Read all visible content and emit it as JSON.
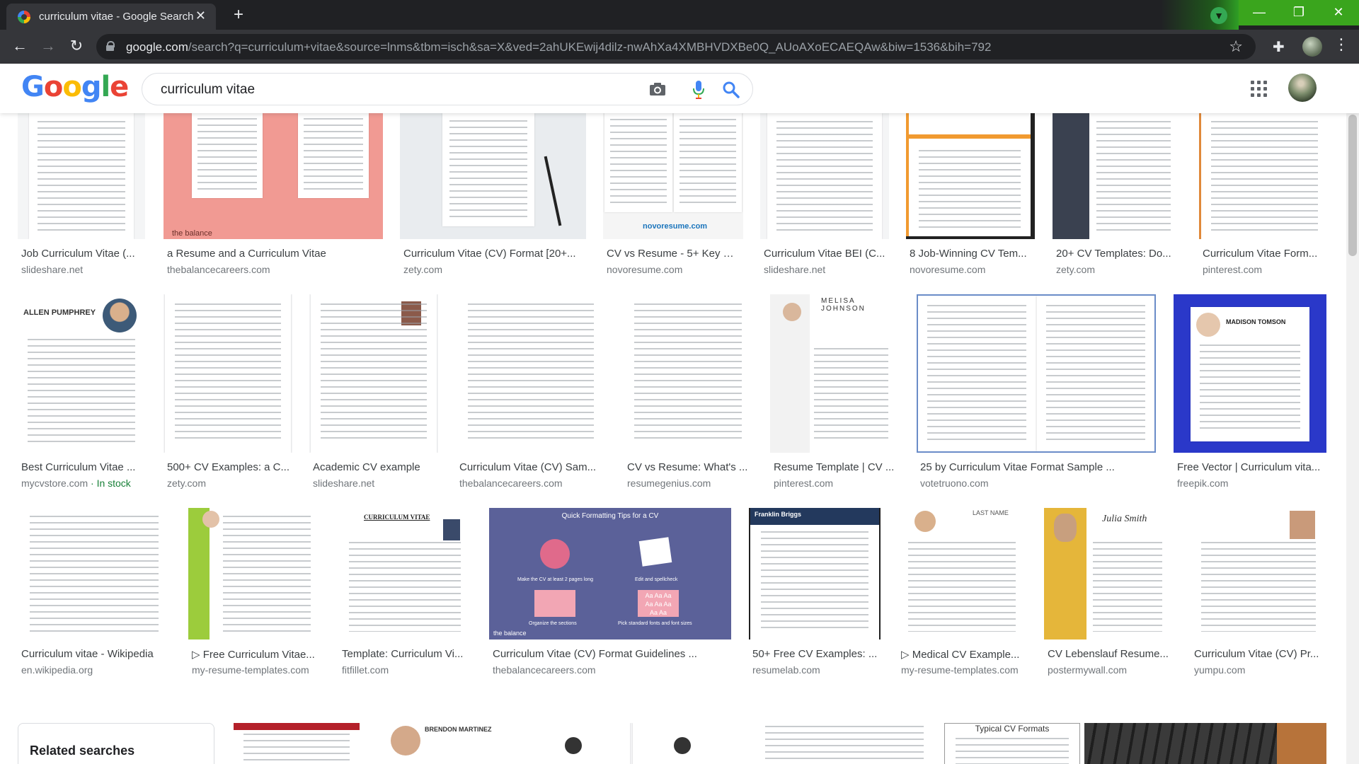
{
  "browser": {
    "tab_title": "curriculum vitae - Google Search",
    "tab_close": "✕",
    "new_tab": "+",
    "window_controls": [
      "—",
      "❐",
      "✕"
    ],
    "url_host": "google.com",
    "url_rest": "/search?q=curriculum+vitae&source=lnms&tbm=isch&sa=X&ved=2ahUKEwij4dilz-nwAhXa4XMBHVDXBe0Q_AUoAXoECAEQAw&biw=1536&bih=792",
    "nav": {
      "back": "←",
      "forward": "→",
      "reload": "↻"
    },
    "bookmark_icon": "☆",
    "extensions_icon": "puzzle-icon",
    "menu_icon": "⋮",
    "accent": "#3aa51d"
  },
  "google": {
    "logo_letters": [
      {
        "ch": "G",
        "color": "#4285f4"
      },
      {
        "ch": "o",
        "color": "#ea4335"
      },
      {
        "ch": "o",
        "color": "#fbbc05"
      },
      {
        "ch": "g",
        "color": "#4285f4"
      },
      {
        "ch": "l",
        "color": "#34a853"
      },
      {
        "ch": "e",
        "color": "#ea4335"
      }
    ],
    "query": "curriculum vitae"
  },
  "results": {
    "row1": [
      {
        "caption": "Job Curriculum Vitae (...",
        "source": "slideshare.net"
      },
      {
        "caption": "a Resume and a Curriculum Vitae",
        "source": "thebalancecareers.com"
      },
      {
        "caption": "Curriculum Vitae (CV) Format [20+...",
        "source": "zety.com"
      },
      {
        "caption": "CV vs Resume - 5+ Key Di...",
        "source": "novoresume.com"
      },
      {
        "caption": "Curriculum Vitae BEI (C...",
        "source": "slideshare.net"
      },
      {
        "caption": "8 Job-Winning CV Tem...",
        "source": "novoresume.com"
      },
      {
        "caption": "20+ CV Templates: Do...",
        "source": "zety.com"
      },
      {
        "caption": "Curriculum Vitae Form...",
        "source": "pinterest.com"
      }
    ],
    "row2": [
      {
        "caption": "Best Curriculum Vitae ...",
        "source": "mycvstore.com",
        "stock": " · In stock"
      },
      {
        "caption": "500+ CV Examples: a C...",
        "source": "zety.com"
      },
      {
        "caption": "Academic CV example",
        "source": "slideshare.net"
      },
      {
        "caption": "Curriculum Vitae (CV) Sam...",
        "source": "thebalancecareers.com"
      },
      {
        "caption": "CV vs Resume: What's ...",
        "source": "resumegenius.com"
      },
      {
        "caption": "Resume Template | CV ...",
        "source": "pinterest.com"
      },
      {
        "caption": "25 by Curriculum Vitae Format Sample ...",
        "source": "votetruono.com"
      },
      {
        "caption": "Free Vector | Curriculum vita...",
        "source": "freepik.com"
      }
    ],
    "row3": [
      {
        "caption": "Curriculum vitae - Wikipedia",
        "source": "en.wikipedia.org"
      },
      {
        "caption": "▷ Free Curriculum Vitae...",
        "source": "my-resume-templates.com"
      },
      {
        "caption": "Template: Curriculum Vi...",
        "source": "fitfillet.com"
      },
      {
        "caption": "Curriculum Vitae (CV) Format Guidelines ...",
        "source": "thebalancecareers.com"
      },
      {
        "caption": "50+ Free CV Examples: ...",
        "source": "resumelab.com"
      },
      {
        "caption": "▷ Medical CV Example...",
        "source": "my-resume-templates.com"
      },
      {
        "caption": "CV Lebenslauf Resume...",
        "source": "postermywall.com"
      },
      {
        "caption": "Curriculum Vitae (CV) Pr...",
        "source": "yumpu.com"
      }
    ],
    "thumb_text": {
      "balance_left": "the balance",
      "novo": "novoresume.com",
      "allen": "ALLEN PUMPHREY",
      "melisa": "MELISA JOHNSON",
      "madison": "MADISON TOMSON",
      "quick_tips": "Quick Formatting Tips for a CV",
      "tip1": "Make the CV at least 2 pages long",
      "tip2": "Edit and spellcheck",
      "tip3": "Organize the sections",
      "tip4": "Pick standard fonts and font sizes",
      "franklin": "Franklin Briggs",
      "julia": "Julia Smith",
      "last_name": "LAST NAME",
      "cv_heading": "CURRICULUM VITAE",
      "brendon": "BRENDON MARTINEZ",
      "typical": "Typical CV Formats"
    },
    "related_title": "Related searches"
  }
}
